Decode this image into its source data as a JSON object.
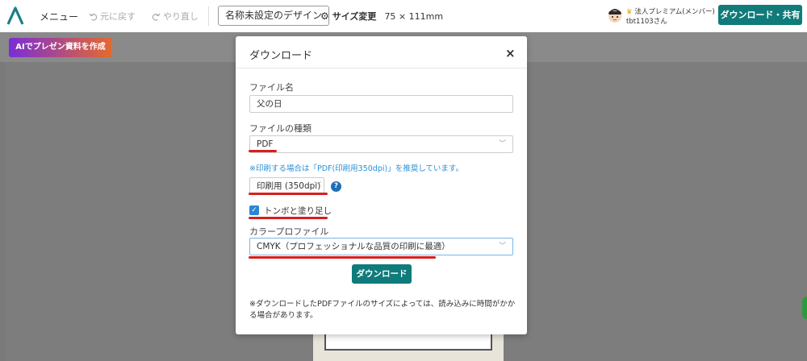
{
  "topbar": {
    "menu_label": "メニュー",
    "undo_label": "元に戻す",
    "redo_label": "やり直し",
    "design_name": "名称未設定のデザイン",
    "size_change_label": "サイズ変更",
    "size_dims": "75 × 111mm",
    "user_plan": "法人プレミアム(メンバー)",
    "user_name": "tbt1103さん",
    "download_share_label": "ダウンロード・共有"
  },
  "subbar": {
    "ai_button_label": "AIでプレゼン資料を作成"
  },
  "modal": {
    "title": "ダウンロード",
    "close_symbol": "×",
    "file_name_label": "ファイル名",
    "file_name_value": "父の日",
    "file_type_label": "ファイルの種類",
    "file_type_value": "PDF",
    "print_note": "※印刷する場合は「PDF(印刷用350dpi)」を推奨しています。",
    "quality_value": "印刷用 (350dpi)",
    "help_symbol": "?",
    "crop_marks_label": "トンボと塗り足し",
    "crop_marks_checked": true,
    "color_profile_label": "カラープロファイル",
    "color_profile_value": "CMYK（プロフェッショナルな品質の印刷に最適）",
    "download_button_label": "ダウンロード",
    "footnote": "※ダウンロードしたPDFファイルのサイズによっては、読み込みに時間がかかる場合があります。"
  },
  "colors": {
    "accent": "#0f7b7a",
    "highlight_red": "#d91e1e",
    "checkbox_blue": "#2a86d6",
    "note_blue": "#2a8fd6"
  },
  "icons": {
    "logo": "app-logo-icon",
    "undo": "undo-icon",
    "redo": "redo-icon",
    "gear": "gear-icon",
    "close": "close-icon",
    "chevron": "chevron-down-icon",
    "help": "help-icon",
    "check": "checkbox-checked-icon"
  }
}
